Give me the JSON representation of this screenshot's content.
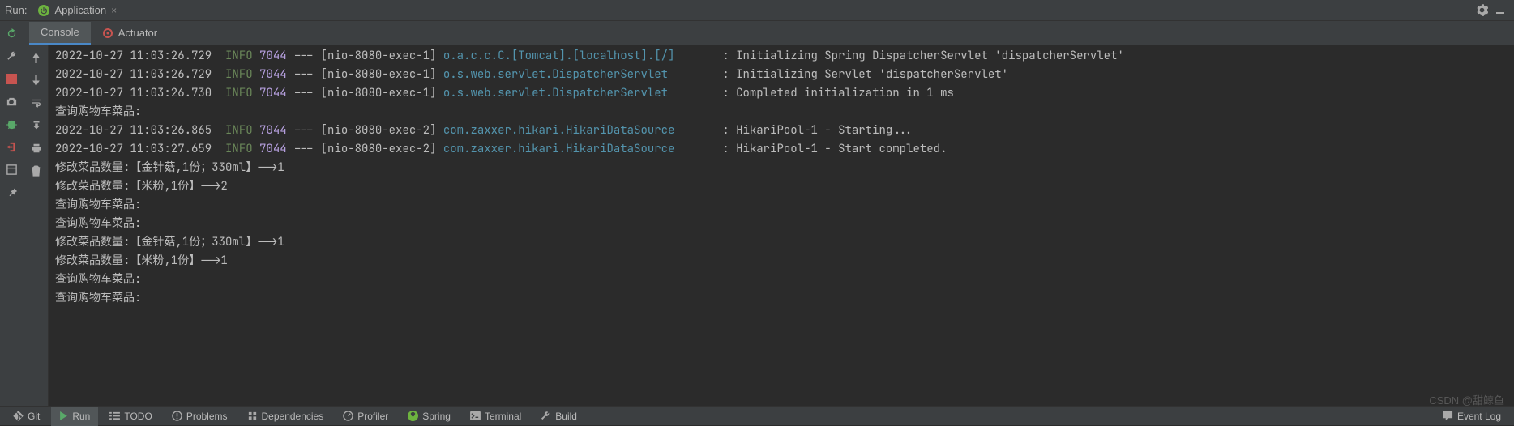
{
  "header": {
    "run_label": "Run:",
    "run_config": "Application"
  },
  "tabs": {
    "console": "Console",
    "actuator": "Actuator"
  },
  "colors": {
    "info": "#6a8759",
    "pid": "#b39ddb",
    "logger": "#5394ad",
    "text": "#bcbcbc"
  },
  "log": [
    {
      "ts": "2022-10-27 11:03:26.729",
      "lvl": "INFO",
      "pid": "7044",
      "thread": "[nio-8080-exec-1]",
      "logger": "o.a.c.c.C.[Tomcat].[localhost].[/]      ",
      "msg": ": Initializing Spring DispatcherServlet 'dispatcherServlet'"
    },
    {
      "ts": "2022-10-27 11:03:26.729",
      "lvl": "INFO",
      "pid": "7044",
      "thread": "[nio-8080-exec-1]",
      "logger": "o.s.web.servlet.DispatcherServlet       ",
      "msg": ": Initializing Servlet 'dispatcherServlet'"
    },
    {
      "ts": "2022-10-27 11:03:26.730",
      "lvl": "INFO",
      "pid": "7044",
      "thread": "[nio-8080-exec-1]",
      "logger": "o.s.web.servlet.DispatcherServlet       ",
      "msg": ": Completed initialization in 1 ms"
    },
    {
      "plain": "查询购物车菜品:"
    },
    {
      "ts": "2022-10-27 11:03:26.865",
      "lvl": "INFO",
      "pid": "7044",
      "thread": "[nio-8080-exec-2]",
      "logger": "com.zaxxer.hikari.HikariDataSource      ",
      "msg": ": HikariPool-1 - Starting..."
    },
    {
      "ts": "2022-10-27 11:03:27.659",
      "lvl": "INFO",
      "pid": "7044",
      "thread": "[nio-8080-exec-2]",
      "logger": "com.zaxxer.hikari.HikariDataSource      ",
      "msg": ": HikariPool-1 - Start completed."
    },
    {
      "plain": "修改菜品数量:【金针菇,1份；330ml】-->1"
    },
    {
      "plain": "修改菜品数量:【米粉,1份】-->2"
    },
    {
      "plain": "查询购物车菜品:"
    },
    {
      "plain": "查询购物车菜品:"
    },
    {
      "plain": "修改菜品数量:【金针菇,1份；330ml】-->1"
    },
    {
      "plain": "修改菜品数量:【米粉,1份】-->1"
    },
    {
      "plain": "查询购物车菜品:"
    },
    {
      "plain": "查询购物车菜品:"
    }
  ],
  "footer": {
    "git": "Git",
    "run": "Run",
    "todo": "TODO",
    "problems": "Problems",
    "dependencies": "Dependencies",
    "profiler": "Profiler",
    "spring": "Spring",
    "terminal": "Terminal",
    "build": "Build",
    "eventlog": "Event Log"
  },
  "watermark": "CSDN @甜鲸鱼"
}
